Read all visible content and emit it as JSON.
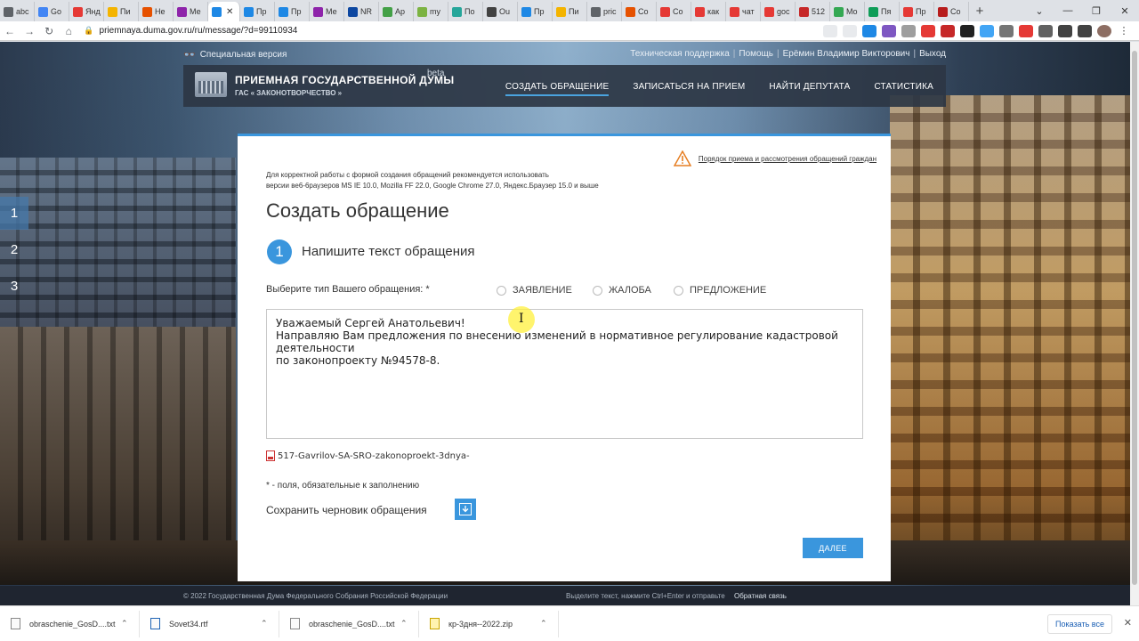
{
  "browser": {
    "tabs": [
      {
        "label": "abc",
        "color": "#5f6368"
      },
      {
        "label": "Go",
        "color": "#4285f4"
      },
      {
        "label": "Янд",
        "color": "#e53935"
      },
      {
        "label": "Пи",
        "color": "#f4b400"
      },
      {
        "label": "Не",
        "color": "#e65100"
      },
      {
        "label": "Ме",
        "color": "#8e24aa"
      },
      {
        "label": "",
        "color": "#1e88e5",
        "active": true
      },
      {
        "label": "Пр",
        "color": "#1e88e5"
      },
      {
        "label": "Пр",
        "color": "#1e88e5"
      },
      {
        "label": "Ме",
        "color": "#8e24aa"
      },
      {
        "label": "NR",
        "color": "#0d47a1"
      },
      {
        "label": "Ар",
        "color": "#43a047"
      },
      {
        "label": "my",
        "color": "#7cb342"
      },
      {
        "label": "По",
        "color": "#26a69a"
      },
      {
        "label": "Ou",
        "color": "#424242"
      },
      {
        "label": "Пр",
        "color": "#1e88e5"
      },
      {
        "label": "Пи",
        "color": "#f4b400"
      },
      {
        "label": "pric",
        "color": "#5f6368"
      },
      {
        "label": "Co",
        "color": "#e65100"
      },
      {
        "label": "Co",
        "color": "#e53935"
      },
      {
        "label": "как",
        "color": "#e53935"
      },
      {
        "label": "чат",
        "color": "#e53935"
      },
      {
        "label": "goc",
        "color": "#e53935"
      },
      {
        "label": "512",
        "color": "#c62828"
      },
      {
        "label": "Mo",
        "color": "#34a853"
      },
      {
        "label": "Пя",
        "color": "#0f9d58"
      },
      {
        "label": "Пр",
        "color": "#e53935"
      },
      {
        "label": "Co",
        "color": "#b71c1c"
      }
    ],
    "url": "priemnaya.duma.gov.ru/ru/message/?d=99110934",
    "downloads": [
      {
        "name": "obraschenie_GosD....txt"
      },
      {
        "name": "Sovet34.rtf"
      },
      {
        "name": "obraschenie_GosD....txt"
      },
      {
        "name": "кр-3дня--2022.zip"
      }
    ],
    "show_all": "Показать все"
  },
  "site": {
    "special_version": "Специальная версия",
    "top_links": [
      "Техническая поддержка",
      "Помощь",
      "Ерёмин Владимир Викторович",
      "Выход"
    ],
    "brand_line1": "ПРИЕМНАЯ ГОСУДАРСТВЕННОЙ ДУМЫ",
    "brand_line2": "ГАС « ЗАКОНОТВОРЧЕСТВО »",
    "beta": "beta",
    "nav": [
      {
        "label": "СОЗДАТЬ ОБРАЩЕНИЕ",
        "active": true
      },
      {
        "label": "ЗАПИСАТЬСЯ НА ПРИЕМ"
      },
      {
        "label": "НАЙТИ ДЕПУТАТА"
      },
      {
        "label": "СТАТИСТИКА"
      }
    ],
    "steps": [
      "1",
      "2",
      "3"
    ]
  },
  "form": {
    "procedure_link": "Порядок приема и рассмотрения обращений граждан",
    "notice_line1": "Для корректной работы с формой создания обращений рекомендуется использовать",
    "notice_line2": "версии ве6-6раузеров MS IE 10.0, Mozilla FF 22.0, Google Chrome 27.0, Яндекс.Браузер 15.0 и выше",
    "title": "Создать обращение",
    "step_number": "1",
    "step_title": "Напишите текст обращения",
    "type_label": "Выберите тип Вашего обращения: *",
    "types": [
      "ЗАЯВЛЕНИЕ",
      "ЖАЛОБА",
      "ПРЕДЛОЖЕНИЕ"
    ],
    "text": "Уважаемый Сергей Анатольевич!\nНаправляю Вам предложения по внесению изменений в нормативное регулирование кадастровой деятельности\nпо законопроекту №94578-8.",
    "attachment": "517-Gavrilov-SA-SRO-zakonoproekt-3dnya-",
    "required_note": "* - поля, обязательные к заполнению",
    "draft_label": "Сохранить черновик обращения",
    "next_button": "ДАЛЕЕ"
  },
  "footer": {
    "copyright": "© 2022 Государственная Дума Федерального Собрания Российской Федерации",
    "tip": "Выделите текст, нажмите Ctrl+Enter и отправьте",
    "feedback": "Обратная связь"
  }
}
